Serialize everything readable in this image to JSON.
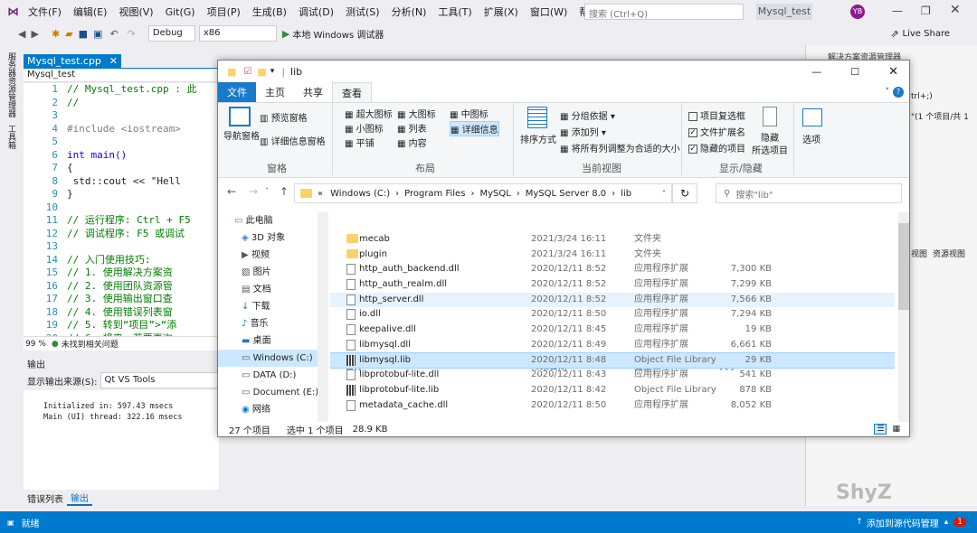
{
  "vs": {
    "menu": [
      "文件(F)",
      "编辑(E)",
      "视图(V)",
      "Git(G)",
      "项目(P)",
      "生成(B)",
      "调试(D)",
      "测试(S)",
      "分析(N)",
      "工具(T)",
      "扩展(X)",
      "窗口(W)",
      "帮助(H)"
    ],
    "search_placeholder": "搜索 (Ctrl+Q)",
    "project_name": "Mysql_test",
    "avatar": "YB",
    "config": "Debug",
    "platform": "x86",
    "run_label": "本地 Windows 调试器",
    "live_share": "Live Share",
    "editor_tab": "Mysql_test.cpp",
    "editor_scope": "Mysql_test",
    "code_lines": [
      {
        "n": "1",
        "t": "// Mysql_test.cpp : 此",
        "c": "cm"
      },
      {
        "n": "2",
        "t": "//",
        "c": "cm"
      },
      {
        "n": "3",
        "t": "",
        "c": ""
      },
      {
        "n": "4",
        "t": "#include <iostream>",
        "c": "inc"
      },
      {
        "n": "5",
        "t": "",
        "c": ""
      },
      {
        "n": "6",
        "t": "int main()",
        "c": "kw"
      },
      {
        "n": "7",
        "t": "{",
        "c": ""
      },
      {
        "n": "8",
        "t": "    std::cout << \"Hell",
        "c": "str"
      },
      {
        "n": "9",
        "t": "}",
        "c": ""
      },
      {
        "n": "10",
        "t": "",
        "c": ""
      },
      {
        "n": "11",
        "t": "// 运行程序: Ctrl + F5",
        "c": "cm"
      },
      {
        "n": "12",
        "t": "// 调试程序: F5 或调试",
        "c": "cm"
      },
      {
        "n": "13",
        "t": "",
        "c": ""
      },
      {
        "n": "14",
        "t": "// 入门使用技巧:",
        "c": "cm"
      },
      {
        "n": "15",
        "t": "//   1. 使用解决方案资",
        "c": "cm"
      },
      {
        "n": "16",
        "t": "//   2. 使用团队资源管",
        "c": "cm"
      },
      {
        "n": "17",
        "t": "//   3. 使用输出窗口查",
        "c": "cm"
      },
      {
        "n": "18",
        "t": "//   4. 使用错误列表窗",
        "c": "cm"
      },
      {
        "n": "19",
        "t": "//   5. 转到“项目”>“添",
        "c": "cm"
      },
      {
        "n": "20",
        "t": "//   6. 将来，若要再次",
        "c": "cm"
      }
    ],
    "zoom": "99 %",
    "issues": "未找到相关问题",
    "output_title": "输出",
    "output_source_label": "显示输出来源(S):",
    "output_source": "Qt VS Tools",
    "output_lines": [
      "Initialized in: 597.43 msecs",
      "Main (UI) thread: 322.16 msecs"
    ],
    "bottom_tabs": [
      "错误列表",
      "输出"
    ],
    "left_strip": [
      "服务器资源管理器",
      "工具箱"
    ],
    "right_panel": [
      "解决方案资源管理器",
      "trl+;)",
      "\"(1 个项目/共 1",
      "视图",
      "资源视图"
    ],
    "status_ready": "就绪",
    "status_source_control": "添加到源代码管理",
    "status_notify": "1",
    "watermark": "ShyZ"
  },
  "explorer": {
    "title": "lib",
    "tabs": [
      "文件",
      "主页",
      "共享",
      "查看"
    ],
    "ribbon": {
      "pane_nav": "导航窗格",
      "preview": "预览窗格",
      "details_pane": "详细信息窗格",
      "pane_group": "窗格",
      "layouts": [
        "超大图标",
        "大图标",
        "中图标",
        "小图标",
        "列表",
        "详细信息",
        "平铺",
        "内容"
      ],
      "layout_group": "布局",
      "sort": "排序方式",
      "group_by": "分组依据",
      "add_col": "添加列",
      "fit_cols": "将所有列调整为合适的大小",
      "view_group": "当前视图",
      "item_checkbox": "项目复选框",
      "file_ext": "文件扩展名",
      "hidden_items": "隐藏的项目",
      "hide": "隐藏",
      "hide_sub": "所选项目",
      "show_group": "显示/隐藏",
      "options": "选项"
    },
    "breadcrumb": [
      "«",
      "Windows (C:)",
      "Program Files",
      "MySQL",
      "MySQL Server 8.0",
      "lib"
    ],
    "search_placeholder": "搜索\"lib\"",
    "nav": [
      "此电脑",
      "3D 对象",
      "视频",
      "图片",
      "文档",
      "下载",
      "音乐",
      "桌面",
      "Windows (C:)",
      "DATA (D:)",
      "Document (E:)",
      "网络"
    ],
    "columns": [
      "名称",
      "修改日期",
      "类型",
      "大小"
    ],
    "files": [
      {
        "name": "mecab",
        "date": "2021/3/24 16:11",
        "type": "文件夹",
        "size": "",
        "icon": "folder"
      },
      {
        "name": "plugin",
        "date": "2021/3/24 16:11",
        "type": "文件夹",
        "size": "",
        "icon": "folder"
      },
      {
        "name": "http_auth_backend.dll",
        "date": "2020/12/11 8:52",
        "type": "应用程序扩展",
        "size": "7,300 KB",
        "icon": "file"
      },
      {
        "name": "http_auth_realm.dll",
        "date": "2020/12/11 8:52",
        "type": "应用程序扩展",
        "size": "7,299 KB",
        "icon": "file"
      },
      {
        "name": "http_server.dll",
        "date": "2020/12/11 8:52",
        "type": "应用程序扩展",
        "size": "7,566 KB",
        "icon": "file"
      },
      {
        "name": "io.dll",
        "date": "2020/12/11 8:50",
        "type": "应用程序扩展",
        "size": "7,294 KB",
        "icon": "file"
      },
      {
        "name": "keepalive.dll",
        "date": "2020/12/11 8:45",
        "type": "应用程序扩展",
        "size": "19 KB",
        "icon": "file"
      },
      {
        "name": "libmysql.dll",
        "date": "2020/12/11 8:49",
        "type": "应用程序扩展",
        "size": "6,661 KB",
        "icon": "file"
      },
      {
        "name": "libmysql.lib",
        "date": "2020/12/11 8:48",
        "type": "Object File Library",
        "size": "29 KB",
        "icon": "lib"
      },
      {
        "name": "libprotobuf-lite.dll",
        "date": "2020/12/11 8:43",
        "type": "应用程序扩展",
        "size": "541 KB",
        "icon": "file"
      },
      {
        "name": "libprotobuf-lite.lib",
        "date": "2020/12/11 8:42",
        "type": "Object File Library",
        "size": "878 KB",
        "icon": "lib"
      },
      {
        "name": "metadata_cache.dll",
        "date": "2020/12/11 8:50",
        "type": "应用程序扩展",
        "size": "8,052 KB",
        "icon": "file"
      }
    ],
    "status_count": "27 个项目",
    "status_selected": "选中 1 个项目",
    "status_size": "28.9 KB"
  }
}
